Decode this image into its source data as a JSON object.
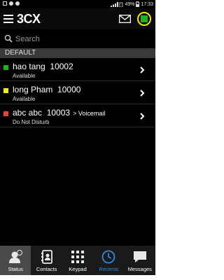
{
  "status_bar": {
    "battery": "49%",
    "time": "17:33"
  },
  "app": {
    "logo_text": "3CX",
    "presence_color": "#1db31d"
  },
  "search": {
    "placeholder": "Search"
  },
  "section": {
    "title": "DEFAULT"
  },
  "contacts": [
    {
      "name": "hao tang",
      "extension": "10002",
      "status": "Available",
      "status_color": "#1db31d",
      "forward": ""
    },
    {
      "name": "long Pham",
      "extension": "10000",
      "status": "Available",
      "status_color": "#f0f000",
      "forward": ""
    },
    {
      "name": "abc abc",
      "extension": "10003",
      "status": "Do Not Disturb",
      "status_color": "#e8413a",
      "forward": "Voicemail"
    }
  ],
  "tabs": [
    {
      "label": "Status",
      "icon": "status-icon",
      "active": true
    },
    {
      "label": "Contacts",
      "icon": "contacts-icon",
      "active": false
    },
    {
      "label": "Keypad",
      "icon": "keypad-icon",
      "active": false
    },
    {
      "label": "Recents",
      "icon": "recents-icon",
      "active": false
    },
    {
      "label": "Messages",
      "icon": "messages-icon",
      "active": false
    }
  ]
}
